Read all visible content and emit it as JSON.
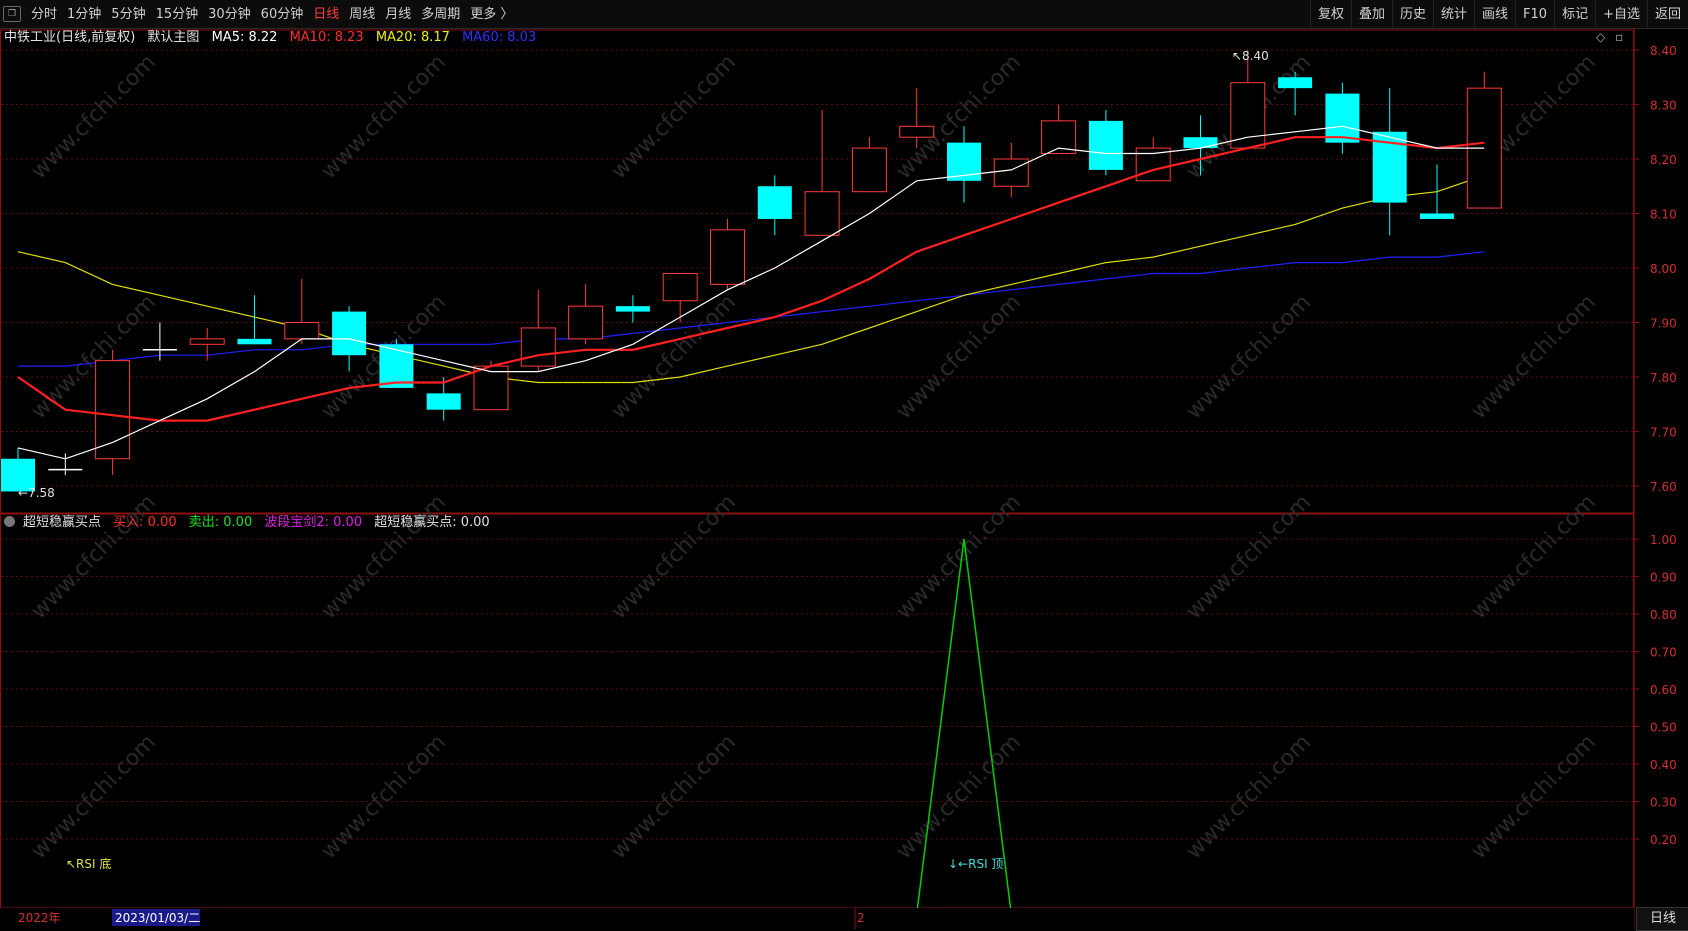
{
  "toolbar": {
    "periods": [
      "分时",
      "1分钟",
      "5分钟",
      "15分钟",
      "30分钟",
      "60分钟",
      "日线",
      "周线",
      "月线",
      "多周期",
      "更多 〉"
    ],
    "active_period": "日线",
    "tools": [
      "复权",
      "叠加",
      "历史",
      "统计",
      "画线",
      "F10",
      "标记",
      "+自选",
      "返回"
    ]
  },
  "main_chart": {
    "title": "中铁工业(日线,前复权)",
    "template": "默认主图",
    "ma5": "MA5: 8.22",
    "ma10": "MA10: 8.23",
    "ma20": "MA20: 8.17",
    "ma60": "MA60: 8.03",
    "high_label": "8.40",
    "low_label": "7.58",
    "y_ticks": [
      "8.40",
      "8.30",
      "8.20",
      "8.10",
      "8.00",
      "7.90",
      "7.80",
      "7.70",
      "7.60"
    ]
  },
  "indicator": {
    "name": "超短稳赢买点",
    "buy": "买入: 0.00",
    "sell": "卖出: 0.00",
    "sword": "波段宝剑2: 0.00",
    "point": "超短稳赢买点: 0.00",
    "y_ticks": [
      "1.00",
      "0.90",
      "0.80",
      "0.70",
      "0.60",
      "0.50",
      "0.40",
      "0.30",
      "0.20"
    ],
    "rsi_bottom": "↖RSI 底",
    "rsi_top": "↓←RSI 顶"
  },
  "timeline": {
    "year_label": "2022年",
    "cursor_date": "2023/01/03/二",
    "month_label": "2"
  },
  "bottom_tab": "日线",
  "watermark": "www.cfchi.com",
  "colors": {
    "up": "#ff3b3b",
    "down": "#00ffff",
    "ma5": "#ffffff",
    "ma10": "#ff2020",
    "ma20": "#e0e000",
    "ma60": "#2020ff",
    "indicator": "#00d000"
  },
  "chart_data": {
    "type": "candlestick",
    "price_range": [
      7.55,
      8.45
    ],
    "candles": [
      {
        "o": 7.65,
        "h": 7.67,
        "l": 7.59,
        "c": 7.59
      },
      {
        "o": 7.63,
        "h": 7.66,
        "l": 7.62,
        "c": 7.63
      },
      {
        "o": 7.65,
        "h": 7.85,
        "l": 7.62,
        "c": 7.83
      },
      {
        "o": 7.85,
        "h": 7.9,
        "l": 7.83,
        "c": 7.85
      },
      {
        "o": 7.86,
        "h": 7.89,
        "l": 7.83,
        "c": 7.87
      },
      {
        "o": 7.87,
        "h": 7.95,
        "l": 7.86,
        "c": 7.86
      },
      {
        "o": 7.87,
        "h": 7.98,
        "l": 7.86,
        "c": 7.9
      },
      {
        "o": 7.92,
        "h": 7.93,
        "l": 7.81,
        "c": 7.84
      },
      {
        "o": 7.86,
        "h": 7.87,
        "l": 7.78,
        "c": 7.78
      },
      {
        "o": 7.77,
        "h": 7.8,
        "l": 7.72,
        "c": 7.74
      },
      {
        "o": 7.74,
        "h": 7.83,
        "l": 7.74,
        "c": 7.82
      },
      {
        "o": 7.82,
        "h": 7.96,
        "l": 7.81,
        "c": 7.89
      },
      {
        "o": 7.87,
        "h": 7.97,
        "l": 7.86,
        "c": 7.93
      },
      {
        "o": 7.93,
        "h": 7.95,
        "l": 7.9,
        "c": 7.92
      },
      {
        "o": 7.94,
        "h": 7.99,
        "l": 7.9,
        "c": 7.99
      },
      {
        "o": 7.97,
        "h": 8.09,
        "l": 7.96,
        "c": 8.07
      },
      {
        "o": 8.15,
        "h": 8.17,
        "l": 8.06,
        "c": 8.09
      },
      {
        "o": 8.06,
        "h": 8.29,
        "l": 8.06,
        "c": 8.14
      },
      {
        "o": 8.14,
        "h": 8.24,
        "l": 8.14,
        "c": 8.22
      },
      {
        "o": 8.24,
        "h": 8.33,
        "l": 8.22,
        "c": 8.26
      },
      {
        "o": 8.23,
        "h": 8.26,
        "l": 8.12,
        "c": 8.16
      },
      {
        "o": 8.15,
        "h": 8.23,
        "l": 8.13,
        "c": 8.2
      },
      {
        "o": 8.21,
        "h": 8.3,
        "l": 8.21,
        "c": 8.27
      },
      {
        "o": 8.27,
        "h": 8.29,
        "l": 8.17,
        "c": 8.18
      },
      {
        "o": 8.16,
        "h": 8.24,
        "l": 8.16,
        "c": 8.22
      },
      {
        "o": 8.24,
        "h": 8.28,
        "l": 8.17,
        "c": 8.22
      },
      {
        "o": 8.22,
        "h": 8.4,
        "l": 8.22,
        "c": 8.34
      },
      {
        "o": 8.35,
        "h": 8.36,
        "l": 8.28,
        "c": 8.33
      },
      {
        "o": 8.32,
        "h": 8.34,
        "l": 8.21,
        "c": 8.23
      },
      {
        "o": 8.25,
        "h": 8.33,
        "l": 8.06,
        "c": 8.12
      },
      {
        "o": 8.1,
        "h": 8.19,
        "l": 8.09,
        "c": 8.09
      },
      {
        "o": 8.11,
        "h": 8.36,
        "l": 8.11,
        "c": 8.33
      }
    ],
    "ma5": [
      7.67,
      7.65,
      7.68,
      7.72,
      7.76,
      7.81,
      7.87,
      7.87,
      7.85,
      7.83,
      7.81,
      7.81,
      7.83,
      7.86,
      7.91,
      7.96,
      8.0,
      8.05,
      8.1,
      8.16,
      8.17,
      8.18,
      8.22,
      8.21,
      8.21,
      8.22,
      8.24,
      8.25,
      8.26,
      8.24,
      8.22,
      8.22
    ],
    "ma10": [
      7.8,
      7.74,
      7.73,
      7.72,
      7.72,
      7.74,
      7.76,
      7.78,
      7.79,
      7.79,
      7.82,
      7.84,
      7.85,
      7.85,
      7.87,
      7.89,
      7.91,
      7.94,
      7.98,
      8.03,
      8.06,
      8.09,
      8.12,
      8.15,
      8.18,
      8.2,
      8.22,
      8.24,
      8.24,
      8.23,
      8.22,
      8.23
    ],
    "ma20": [
      8.03,
      8.01,
      7.97,
      7.95,
      7.93,
      7.91,
      7.89,
      7.86,
      7.84,
      7.82,
      7.8,
      7.79,
      7.79,
      7.79,
      7.8,
      7.82,
      7.84,
      7.86,
      7.89,
      7.92,
      7.95,
      7.97,
      7.99,
      8.01,
      8.02,
      8.04,
      8.06,
      8.08,
      8.11,
      8.13,
      8.14,
      8.17
    ],
    "ma60": [
      7.82,
      7.82,
      7.83,
      7.84,
      7.84,
      7.85,
      7.85,
      7.86,
      7.86,
      7.86,
      7.86,
      7.87,
      7.87,
      7.88,
      7.89,
      7.9,
      7.91,
      7.92,
      7.93,
      7.94,
      7.95,
      7.96,
      7.97,
      7.98,
      7.99,
      7.99,
      8.0,
      8.01,
      8.01,
      8.02,
      8.02,
      8.03
    ],
    "indicator_range": [
      0.0,
      1.05
    ],
    "indicator_points": [
      {
        "i": 19.0,
        "v": 0.0
      },
      {
        "i": 20.0,
        "v": 1.0
      },
      {
        "i": 21.0,
        "v": 0.0
      }
    ]
  }
}
